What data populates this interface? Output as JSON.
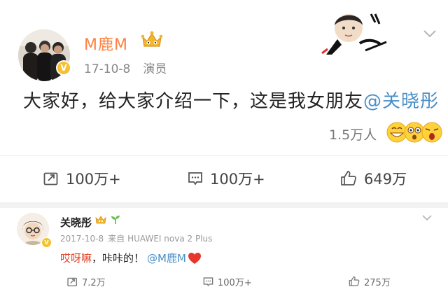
{
  "post": {
    "author": "M鹿M",
    "date": "17-10-8",
    "source": "演员",
    "text_main": "大家好，给大家介绍一下，这是我女朋友",
    "mention": "@关晓彤",
    "likers_count": "1.5万人",
    "actions": {
      "repost": "100万+",
      "comment": "100万+",
      "like": "649万"
    },
    "verified_badge": "V"
  },
  "comment": {
    "author": "关晓彤",
    "date": "2017-10-8",
    "source_prefix": "来自",
    "source_device": "HUAWEI nova 2 Plus",
    "text_red": "哎呀嘛",
    "text_rest": "，咔咔的！",
    "mention": "@M鹿M",
    "actions": {
      "repost": "7.2万",
      "comment": "100万+",
      "like": "275万"
    },
    "verified_badge": "V"
  },
  "colors": {
    "author_orange": "#ff8140",
    "mention_blue": "#4a8fc6",
    "accent_red": "#e2452b",
    "badge_gold": "#f6c02f"
  },
  "icons": [
    "crown-icon",
    "chevron-down-icon",
    "repost-icon",
    "comment-icon",
    "like-icon",
    "heart-icon",
    "sprout-icon",
    "verified-icon"
  ]
}
